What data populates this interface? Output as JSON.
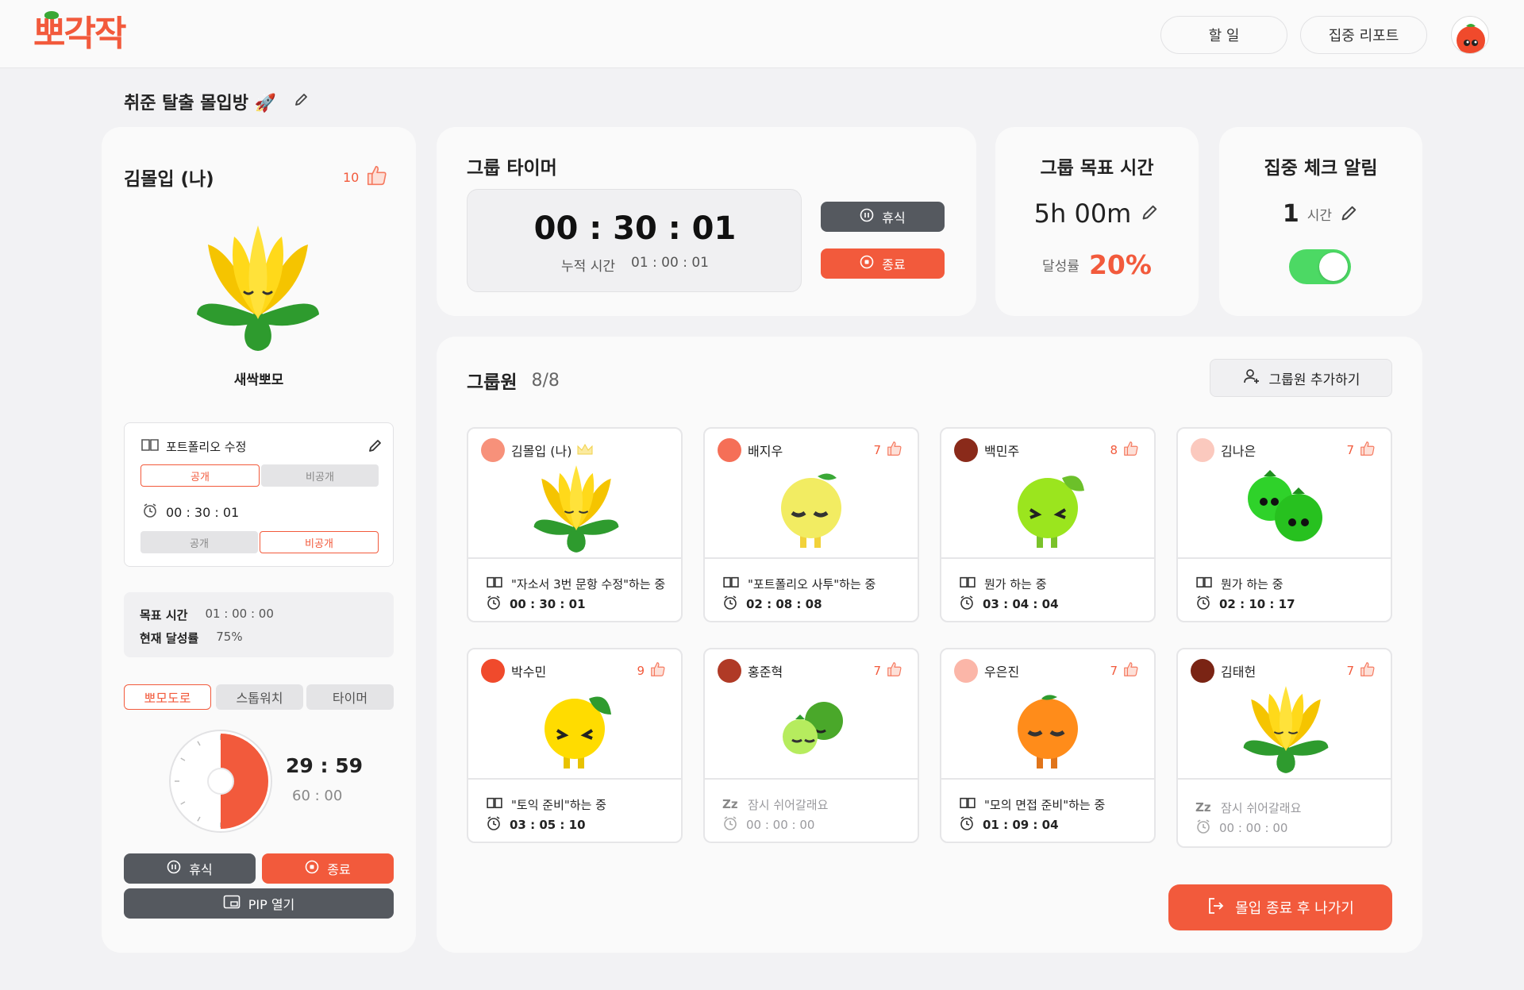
{
  "app": {
    "logo": "뽀각작"
  },
  "nav": {
    "todo": "할 일",
    "report": "집중 리포트"
  },
  "room": {
    "title": "취준 탈출 몰입방 🚀"
  },
  "profile": {
    "name": "김몰입 (나)",
    "likes": "10",
    "character_name": "새싹뽀모",
    "task": {
      "title": "포트폴리오 수정",
      "visibility_public": "공개",
      "visibility_private": "비공개",
      "time": "00 : 30 : 01",
      "time_public": "공개",
      "time_private": "비공개"
    },
    "goal_label": "목표 시간",
    "goal_value": "01 : 00 : 00",
    "rate_label": "현재 달성률",
    "rate_value": "75%",
    "modes": [
      "뽀모도로",
      "스톱워치",
      "타이머"
    ],
    "pomodoro": {
      "remaining": "29 : 59",
      "total": "60 : 00",
      "progress": 0.5
    },
    "rest_label": "휴식",
    "end_label": "종료",
    "pip_label": "PIP 열기"
  },
  "group_timer": {
    "title": "그룹 타이머",
    "time": "00 : 30 : 01",
    "cumulative_label": "누적 시간",
    "cumulative_value": "01 : 00 : 01",
    "rest_label": "휴식",
    "end_label": "종료"
  },
  "group_goal": {
    "title": "그룹 목표 시간",
    "value": "5h 00m",
    "rate_label": "달성률",
    "rate_value": "20%"
  },
  "focus_alarm": {
    "title": "집중 체크 알림",
    "value": "1",
    "unit": "시간",
    "enabled": true
  },
  "members_section": {
    "title": "그룹원",
    "count": "8/8",
    "add_label": "그룹원 추가하기",
    "exit_label": "몰입 종료 후 나가기"
  },
  "members": [
    {
      "name": "김몰입 (나)",
      "likes": "",
      "crown": true,
      "color": "#f7917a",
      "status": "\"자소서 3번 문항 수정\"하는 중",
      "time": "00 : 30 : 01",
      "resting": false,
      "character": "flower"
    },
    {
      "name": "배지우",
      "likes": "7",
      "crown": false,
      "color": "#f56f57",
      "status": "\"포트폴리오 사투\"하는 중",
      "time": "02 : 08 : 08",
      "resting": false,
      "character": "yellow-ball"
    },
    {
      "name": "백민주",
      "likes": "8",
      "crown": false,
      "color": "#8a2a1a",
      "status": "뭔가 하는 중",
      "time": "03 : 04 : 04",
      "resting": false,
      "character": "lime"
    },
    {
      "name": "김나은",
      "likes": "7",
      "crown": false,
      "color": "#fbc9be",
      "status": "뭔가 하는 중",
      "time": "02 : 10 : 17",
      "resting": false,
      "character": "green-duo"
    },
    {
      "name": "박수민",
      "likes": "9",
      "crown": false,
      "color": "#f04a2c",
      "status": "\"토익 준비\"하는 중",
      "time": "03 : 05 : 10",
      "resting": false,
      "character": "yellow-lemon"
    },
    {
      "name": "홍준혁",
      "likes": "7",
      "crown": false,
      "color": "#b03a26",
      "status": "잠시 쉬어갈래요",
      "time": "00 : 00 : 00",
      "resting": true,
      "character": "green-pair"
    },
    {
      "name": "우은진",
      "likes": "7",
      "crown": false,
      "color": "#fbb6a8",
      "status": "\"모의 면접 준비\"하는 중",
      "time": "01 : 09 : 04",
      "resting": false,
      "character": "orange"
    },
    {
      "name": "김태헌",
      "likes": "7",
      "crown": false,
      "color": "#7a2414",
      "status": "잠시 쉬어갈래요",
      "time": "00 : 00 : 00",
      "resting": true,
      "character": "flower"
    }
  ],
  "colors": {
    "accent": "#f25a3c",
    "dark": "#55595f",
    "toggle": "#4cd964"
  }
}
